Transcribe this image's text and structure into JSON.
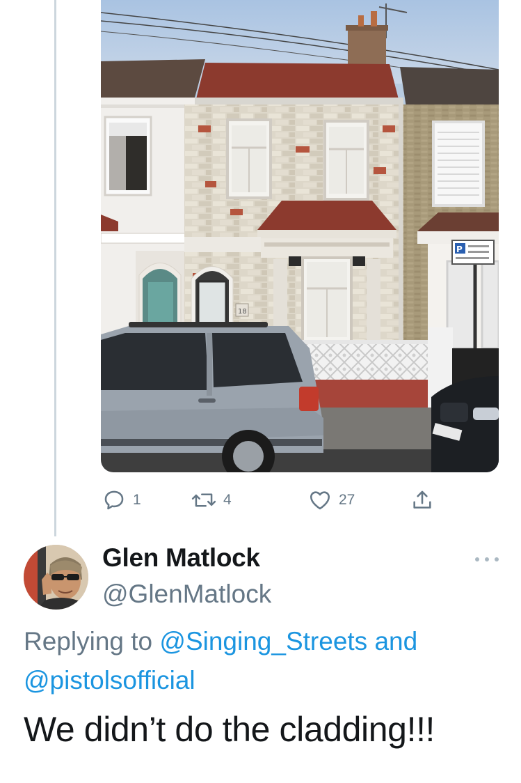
{
  "previous_tweet": {
    "media": {
      "house_number": "18",
      "parking_sign_letter": "P"
    },
    "actions": {
      "replies": "1",
      "retweets": "4",
      "likes": "27"
    }
  },
  "reply": {
    "author_name": "Glen Matlock",
    "author_handle": "@GlenMatlock",
    "replying_prefix": "Replying to",
    "mention_1": "@Singing_Streets",
    "conjunction": "and",
    "mention_2": "@pistolsofficial",
    "text": "We didn’t do the cladding!!!"
  },
  "colors": {
    "secondary_text": "#657786",
    "link": "#1b95e0",
    "thread_line": "#ccd6dd"
  },
  "icons": [
    "reply-icon",
    "retweet-icon",
    "like-icon",
    "share-icon",
    "more-icon"
  ]
}
